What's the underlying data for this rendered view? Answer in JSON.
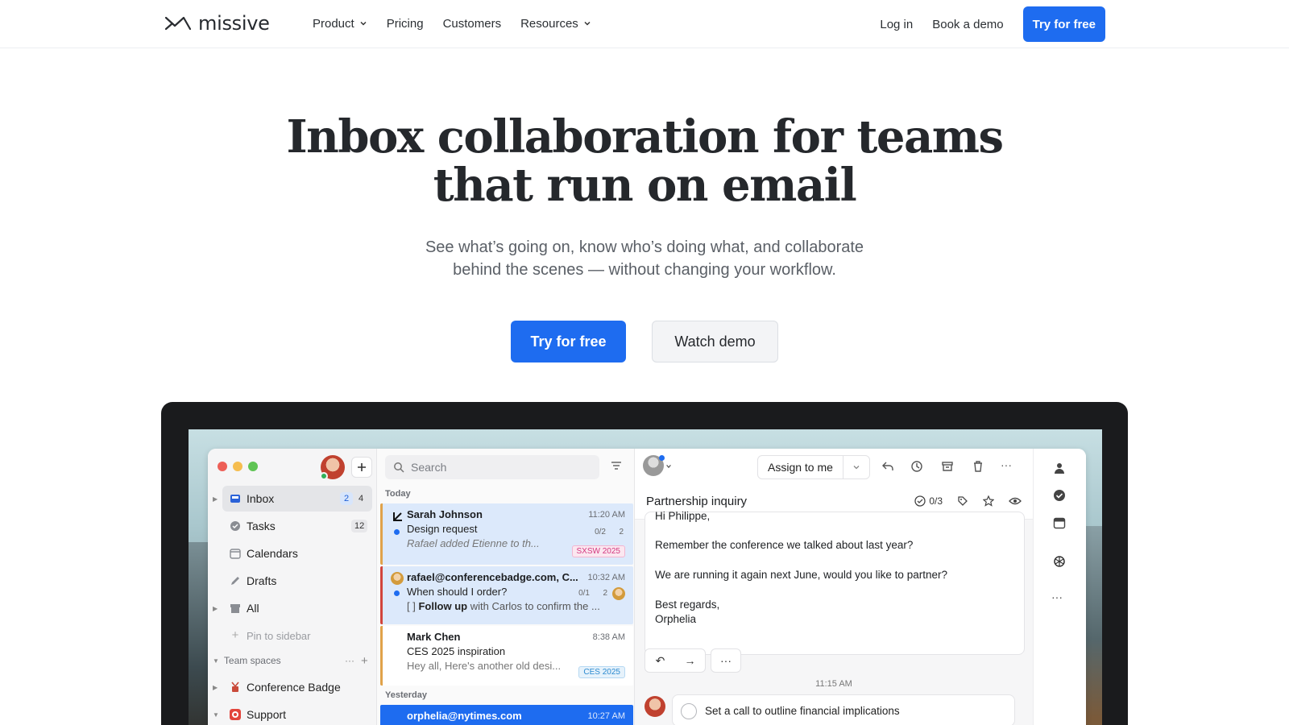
{
  "brand": {
    "name": "missive"
  },
  "nav": {
    "links": [
      {
        "label": "Product",
        "dropdown": true
      },
      {
        "label": "Pricing",
        "dropdown": false
      },
      {
        "label": "Customers",
        "dropdown": false
      },
      {
        "label": "Resources",
        "dropdown": true
      }
    ],
    "login": "Log in",
    "book_demo": "Book a demo",
    "try_free": "Try for free"
  },
  "hero": {
    "title_line1": "Inbox collaboration for teams",
    "title_line2": "that run on email",
    "subtitle_line1": "See what’s going on, know who’s doing what, and collaborate",
    "subtitle_line2": "behind the scenes — without changing your workflow.",
    "cta_primary": "Try for free",
    "cta_secondary": "Watch demo"
  },
  "colors": {
    "accent": "#1e6cf0",
    "traffic_red": "#ed5f57",
    "traffic_yellow": "#f5bd4f",
    "traffic_green": "#5fc454"
  },
  "app": {
    "sidebar": {
      "items": [
        {
          "label": "Inbox",
          "icon": "inbox-icon",
          "badge1": "2",
          "badge2": "4"
        },
        {
          "label": "Tasks",
          "icon": "check-circle-icon",
          "badge": "12"
        },
        {
          "label": "Calendars",
          "icon": "calendar-icon"
        },
        {
          "label": "Drafts",
          "icon": "pencil-icon"
        },
        {
          "label": "All",
          "icon": "archive-box-icon"
        },
        {
          "label": "Pin to sidebar",
          "icon": "plus-icon"
        }
      ],
      "section_label": "Team spaces",
      "teams": [
        {
          "label": "Conference Badge",
          "icon": "badge-icon"
        },
        {
          "label": "Support",
          "icon": "support-icon"
        }
      ]
    },
    "list": {
      "search_placeholder": "Search",
      "today_label": "Today",
      "yesterday_label": "Yesterday",
      "messages": [
        {
          "sender": "Sarah Johnson",
          "time": "11:20 AM",
          "subject": "Design request",
          "tasks": "0/2",
          "count": "2",
          "preview": "Rafael added Etienne to th...",
          "tag": "SXSW 2025"
        },
        {
          "sender": "rafael@conferencebadge.com, C...",
          "time": "10:32 AM",
          "subject": "When should I order?",
          "tasks": "0/1",
          "count": "2",
          "preview_prefix": "[ ] ",
          "preview_bold": "Follow up",
          "preview": " with Carlos to confirm the ..."
        },
        {
          "sender": "Mark Chen",
          "time": "8:38 AM",
          "subject": "CES 2025 inspiration",
          "preview": "Hey all, Here's another old desi...",
          "tag": "CES 2025"
        },
        {
          "sender": "orphelia@nytimes.com",
          "time": "10:27 AM"
        }
      ]
    },
    "conversation": {
      "assign_label": "Assign to me",
      "subject": "Partnership inquiry",
      "task_count": "0/3",
      "body": [
        "Hi Philippe,",
        "Remember the conference we talked about last year?",
        "We are running it again next June, would you like to partner?",
        "Best regards,",
        "Orphelia"
      ],
      "timestamp": "11:15 AM",
      "task": "Set a call to outline financial implications"
    }
  }
}
